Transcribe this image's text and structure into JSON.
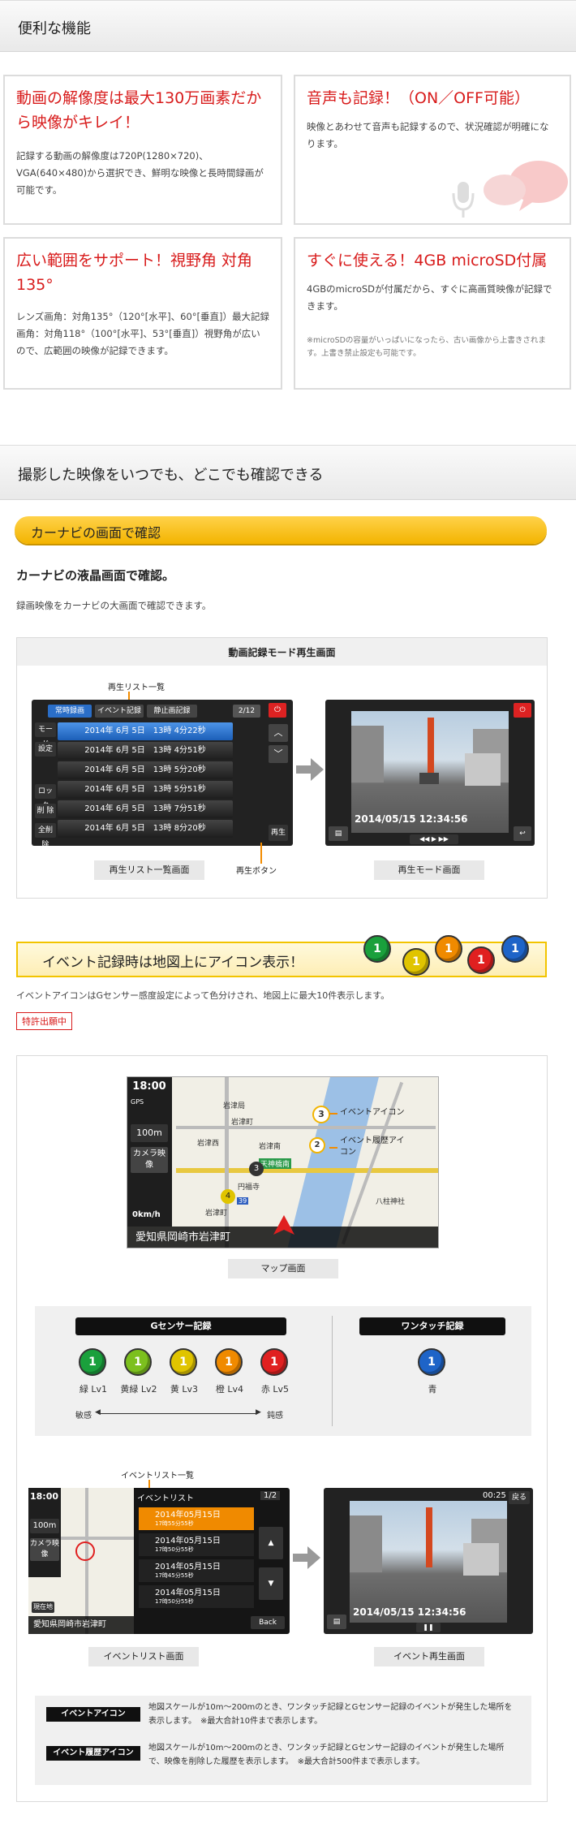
{
  "section1": {
    "title": "便利な機能"
  },
  "features": [
    {
      "title": "動画の解像度は最大130万画素だから映像がキレイ！",
      "body": "記録する動画の解像度は720P(1280×720)、VGA(640×480)から選択でき、鮮明な映像と長時間録画が可能です。"
    },
    {
      "title": "音声も記録！（ON／OFF可能）",
      "body": "映像とあわせて音声も記録するので、状況確認が明確になります。"
    },
    {
      "title": "広い範囲をサポート！視野角 対角135°",
      "body": "レンズ画角：対角135°（120°[水平]、60°[垂直]）最大記録画角：対角118°（100°[水平]、53°[垂直]）視野角が広いので、広範囲の映像が記録できます。"
    },
    {
      "title": "すぐに使える！4GB microSD付属",
      "body": "4GBのmicroSDが付属だから、すぐに高画質映像が記録できます。",
      "note": "※microSDの容量がいっぱいになったら、古い画像から上書きされます。上書き禁止設定も可能です。"
    }
  ],
  "section2": {
    "title": "撮影した映像をいつでも、どこでも確認できる"
  },
  "navi": {
    "pill": "カーナビの画面で確認",
    "heading": "カーナビの液晶画面で確認。",
    "desc": "録画映像をカーナビの大画面で確認できます。",
    "panel_title": "動画記録モード再生画面",
    "list_caption": "再生リスト一覧",
    "play_caption": "再生ボタン",
    "list_label": "再生リスト一覧画面",
    "mode_label": "再生モード画面",
    "tabs": [
      "常時録画",
      "イベント記録",
      "静止画記録"
    ],
    "page": "2/12",
    "side_buttons": [
      "モード",
      "設定",
      "ロック",
      "削 除",
      "全削除"
    ],
    "rows": [
      "2014年 6月 5日　13時 4分22秒",
      "2014年 6月 5日　13時 4分51秒",
      "2014年 6月 5日　13時 5分20秒",
      "2014年 6月 5日　13時 5分51秒",
      "2014年 6月 5日　13時 7分51秒",
      "2014年 6月 5日　13時 8分20秒"
    ],
    "play_btn": "再生",
    "timestamp": "2014/05/15 12:34:56"
  },
  "event": {
    "banner": "イベント記録時は地図上にアイコン表示！",
    "desc": "イベントアイコンはGセンサー感度設定によって色分けされ、地図上に最大10件表示します。",
    "patent": "特許出願中",
    "map_label": "マップ画面",
    "event_icon_label": "イベントアイコン",
    "history_icon_label": "イベント履歴アイコン",
    "map": {
      "time": "18:00",
      "gps": "GPS",
      "scale": "100m",
      "camera": "カメラ映像",
      "speed": "0km/h",
      "address": "愛知県岡崎市岩津町",
      "places": [
        "岩津局",
        "岩津町",
        "岩津西",
        "岩津南",
        "天神橋南",
        "円福寺",
        "八柱神社",
        "岩津町"
      ],
      "route": "39"
    },
    "gsensor_title": "Gセンサー記録",
    "onetouch_title": "ワンタッチ記録",
    "levels": [
      {
        "label": "緑 Lv1",
        "color": "#1aa03c"
      },
      {
        "label": "黄緑 Lv2",
        "color": "#7cc01e"
      },
      {
        "label": "黄 Lv3",
        "color": "#e0c400"
      },
      {
        "label": "橙 Lv4",
        "color": "#f08a00"
      },
      {
        "label": "赤 Lv5",
        "color": "#e02020"
      }
    ],
    "onetouch": {
      "label": "青",
      "color": "#1e64c8"
    },
    "sensitive": "敏感",
    "dull": "鈍感",
    "list_caption": "イベントリスト一覧",
    "event_list_title": "イベントリスト",
    "event_list_page": "1/2",
    "event_items": [
      {
        "date": "2014年05月15日",
        "time": "17時55分55秒"
      },
      {
        "date": "2014年05月15日",
        "time": "17時50分55秒"
      },
      {
        "date": "2014年05月15日",
        "time": "17時45分55秒"
      },
      {
        "date": "2014年05月15日",
        "time": "17時50分55秒"
      }
    ],
    "back": "Back",
    "current": "現在地",
    "list_screen_label": "イベントリスト画面",
    "play_screen_label": "イベント再生画面",
    "play_time": "00:25",
    "return": "戻る",
    "legend": [
      {
        "tag": "イベントアイコン",
        "text": "地図スケールが10m〜200mのとき、ワンタッチ記録とGセンサー記録のイベントが発生した場所を表示します。　※最大合計10件まで表示します。"
      },
      {
        "tag": "イベント履歴アイコン",
        "text": "地図スケールが10m〜200mのとき、ワンタッチ記録とGセンサー記録のイベントが発生した場所で、映像を削除した履歴を表示します。　※最大合計500件まで表示します。"
      }
    ]
  }
}
